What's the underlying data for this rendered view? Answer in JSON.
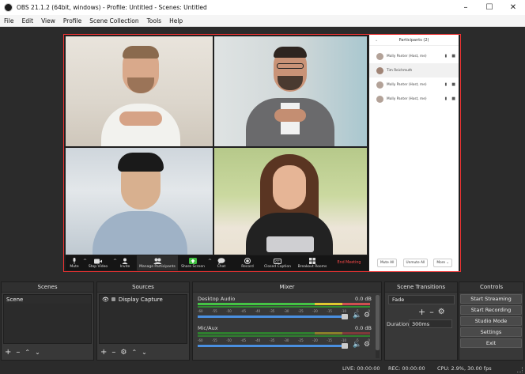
{
  "window": {
    "title": "OBS 21.1.2 (64bit, windows) - Profile: Untitled - Scenes: Untitled"
  },
  "menu": [
    "File",
    "Edit",
    "View",
    "Profile",
    "Scene Collection",
    "Tools",
    "Help"
  ],
  "zoom_toolbar": {
    "items": [
      "Mute",
      "Stop Video",
      "Invite",
      "Manage Participants",
      "Share Screen",
      "Chat",
      "Record",
      "Closed Caption",
      "Breakout Rooms"
    ],
    "end": "End Meeting"
  },
  "participants_panel": {
    "header": "Participants (2)",
    "rows": [
      "Molly Panter (Host, me)",
      "Tim Reichmuth",
      "Molly Panter (Host, me)",
      "Molly Panter (Host, me)"
    ],
    "mute_all": "Mute All",
    "unmute_all": "Unmute All",
    "more": "More"
  },
  "docks": {
    "scenes": {
      "title": "Scenes",
      "items": [
        "Scene"
      ]
    },
    "sources": {
      "title": "Sources",
      "items": [
        "Display Capture"
      ]
    },
    "mixer": {
      "title": "Mixer",
      "channels": [
        {
          "name": "Desktop Audio",
          "level": "0.0 dB",
          "volume": 0.97
        },
        {
          "name": "Mic/Aux",
          "level": "0.0 dB",
          "volume": 0.97
        }
      ],
      "scale": [
        "-60",
        "-55",
        "-50",
        "-45",
        "-40",
        "-35",
        "-30",
        "-25",
        "-20",
        "-15",
        "-10",
        "-5",
        "0"
      ]
    },
    "transitions": {
      "title": "Scene Transitions",
      "selected": "Fade",
      "duration_label": "Duration",
      "duration_value": "300ms"
    },
    "controls": {
      "title": "Controls",
      "buttons": [
        "Start Streaming",
        "Start Recording",
        "Studio Mode",
        "Settings",
        "Exit"
      ]
    }
  },
  "status": {
    "live": "LIVE: 00:00:00",
    "rec": "REC: 00:00:00",
    "cpu": "CPU: 2.9%, 30.00 fps"
  },
  "colors": {
    "accent_red": "#e33333",
    "meter_green": "#46c346",
    "meter_yellow": "#e0c830",
    "meter_red": "#d05050",
    "volume_blue": "#4a8fe0"
  }
}
